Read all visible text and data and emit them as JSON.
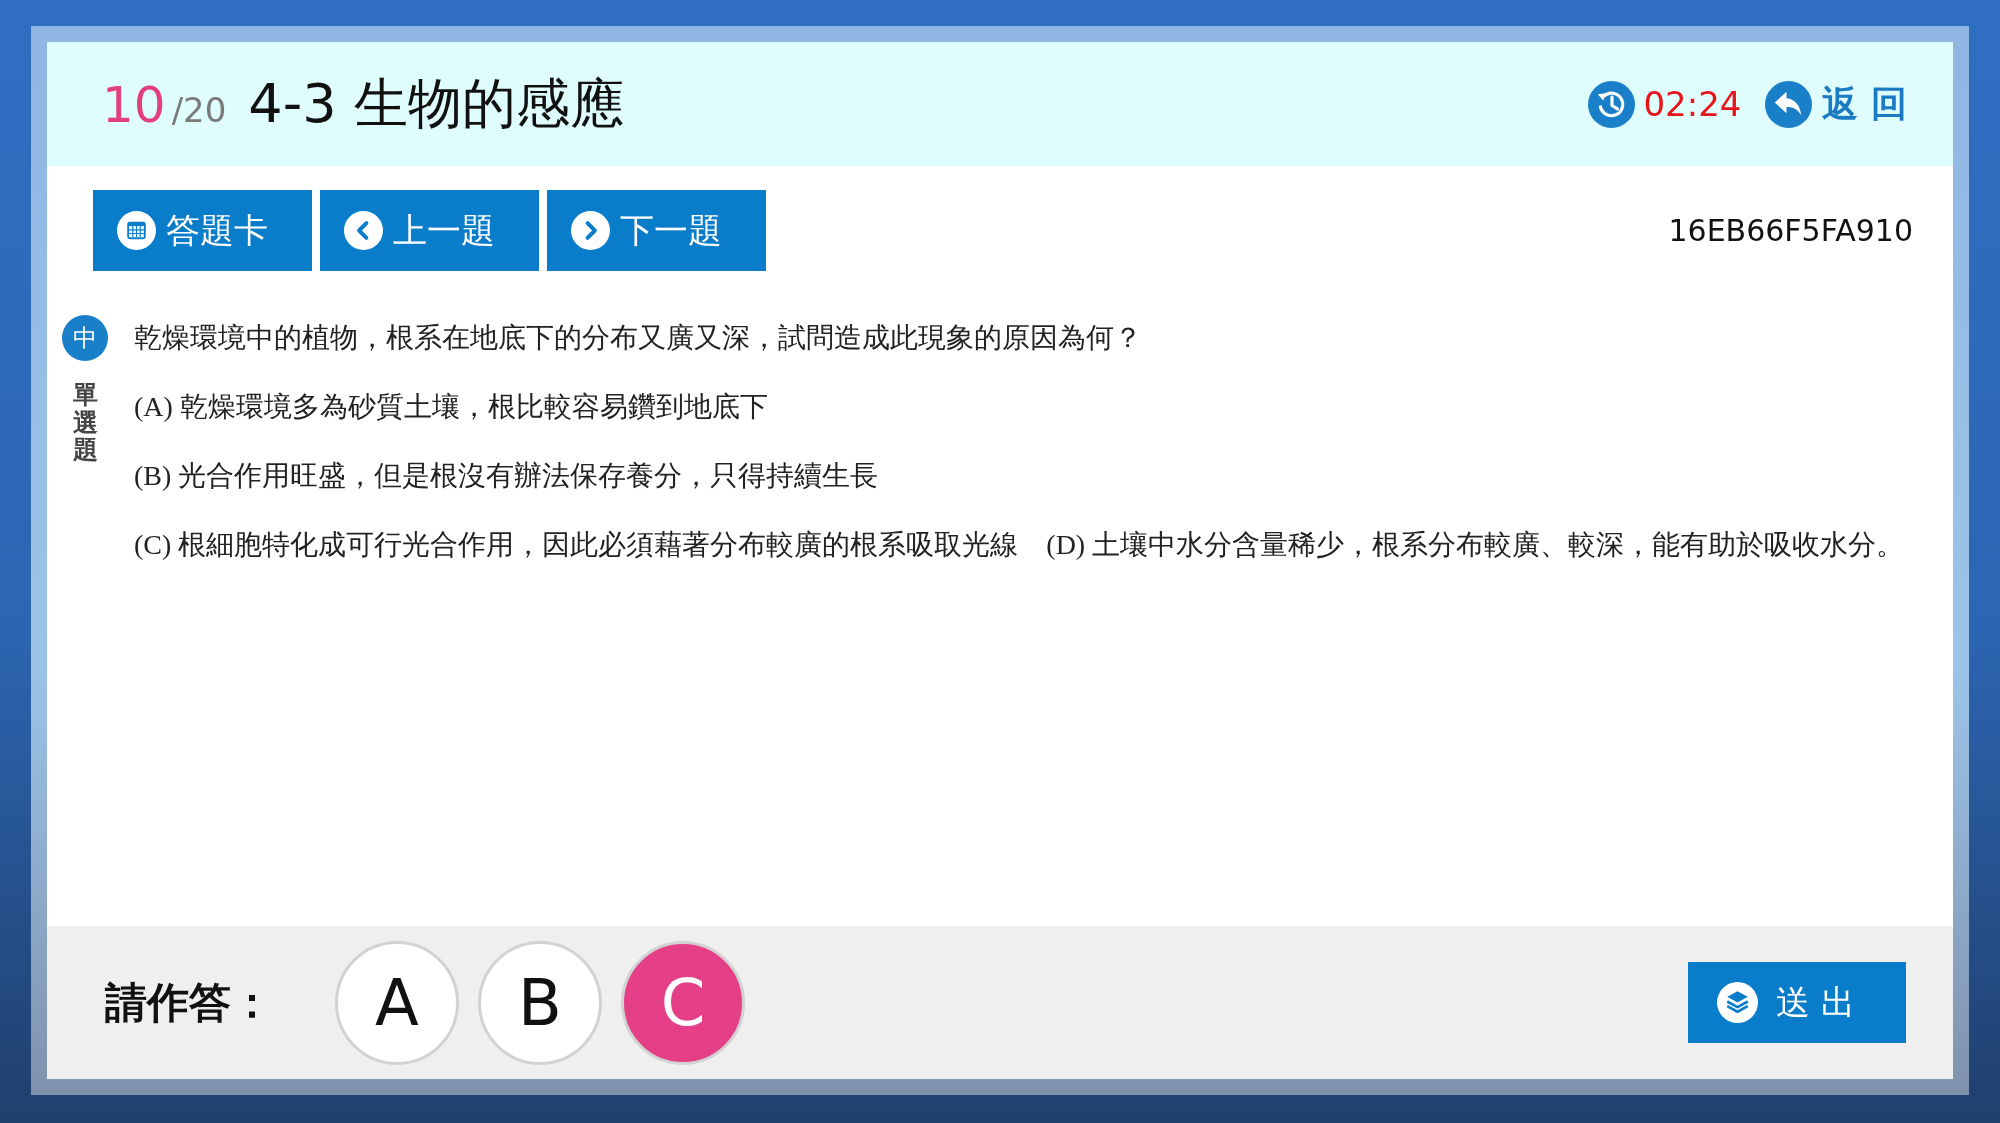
{
  "header": {
    "question_number": "10",
    "question_total": "/20",
    "title": "4-3 生物的感應",
    "timer": "02:24",
    "back_button": "返 回"
  },
  "toolbar": {
    "buttons": [
      {
        "kind": "card",
        "label": "答題卡"
      },
      {
        "kind": "prev",
        "label": "上一題"
      },
      {
        "kind": "next",
        "label": "下一題"
      }
    ],
    "question_code": "16EB66F5FA910"
  },
  "question": {
    "difficulty": "中",
    "type": "單選題",
    "stem": "乾燥環境中的植物，根系在地底下的分布又廣又深，試問造成此現象的原因為何？",
    "option_rows": [
      [
        {
          "text": "(A) 乾燥環境多為砂質土壤，根比較容易鑽到地底下"
        }
      ],
      [
        {
          "text": "(B) 光合作用旺盛，但是根沒有辦法保存養分，只得持續生長"
        }
      ],
      [
        {
          "text": "(C) 根細胞特化成可行光合作用，因此必須藉著分布較廣的根系吸取光線"
        },
        {
          "text": "(D) 土壤中水分含量稀少，根系分布較廣、較深，能有助於吸收水分。"
        }
      ]
    ]
  },
  "answer_bar": {
    "prompt": "請作答：",
    "choices": [
      {
        "label": "A",
        "selected": false
      },
      {
        "label": "B",
        "selected": false
      },
      {
        "label": "C",
        "selected": true
      }
    ],
    "submit_button": "送 出"
  }
}
